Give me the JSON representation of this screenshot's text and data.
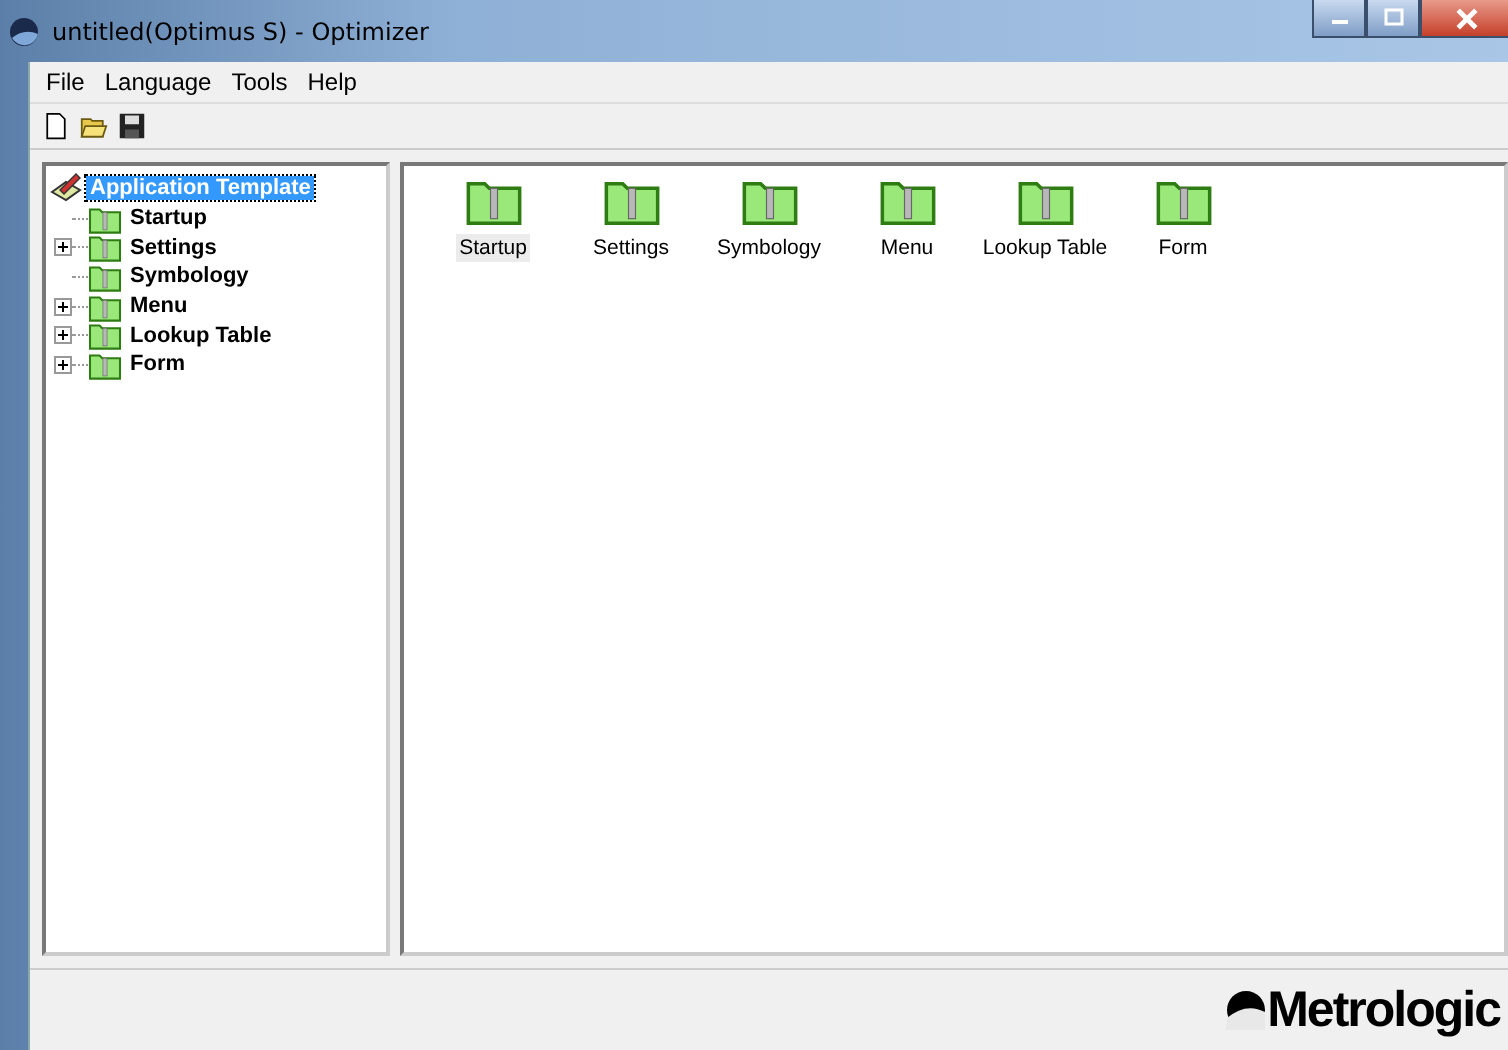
{
  "window": {
    "title": "untitled(Optimus S) - Optimizer"
  },
  "menu": [
    "File",
    "Language",
    "Tools",
    "Help"
  ],
  "tree": {
    "root": {
      "label": "Application Template",
      "selected": true
    },
    "children": [
      {
        "label": "Startup",
        "expandable": false
      },
      {
        "label": "Settings",
        "expandable": true
      },
      {
        "label": "Symbology",
        "expandable": false
      },
      {
        "label": "Menu",
        "expandable": true
      },
      {
        "label": "Lookup Table",
        "expandable": true
      },
      {
        "label": "Form",
        "expandable": true
      }
    ]
  },
  "icons": [
    {
      "label": "Startup",
      "selected": true
    },
    {
      "label": "Settings",
      "selected": false
    },
    {
      "label": "Symbology",
      "selected": false
    },
    {
      "label": "Menu",
      "selected": false
    },
    {
      "label": "Lookup Table",
      "selected": false
    },
    {
      "label": "Form",
      "selected": false
    }
  ],
  "logo": {
    "text": "Metrologic"
  }
}
